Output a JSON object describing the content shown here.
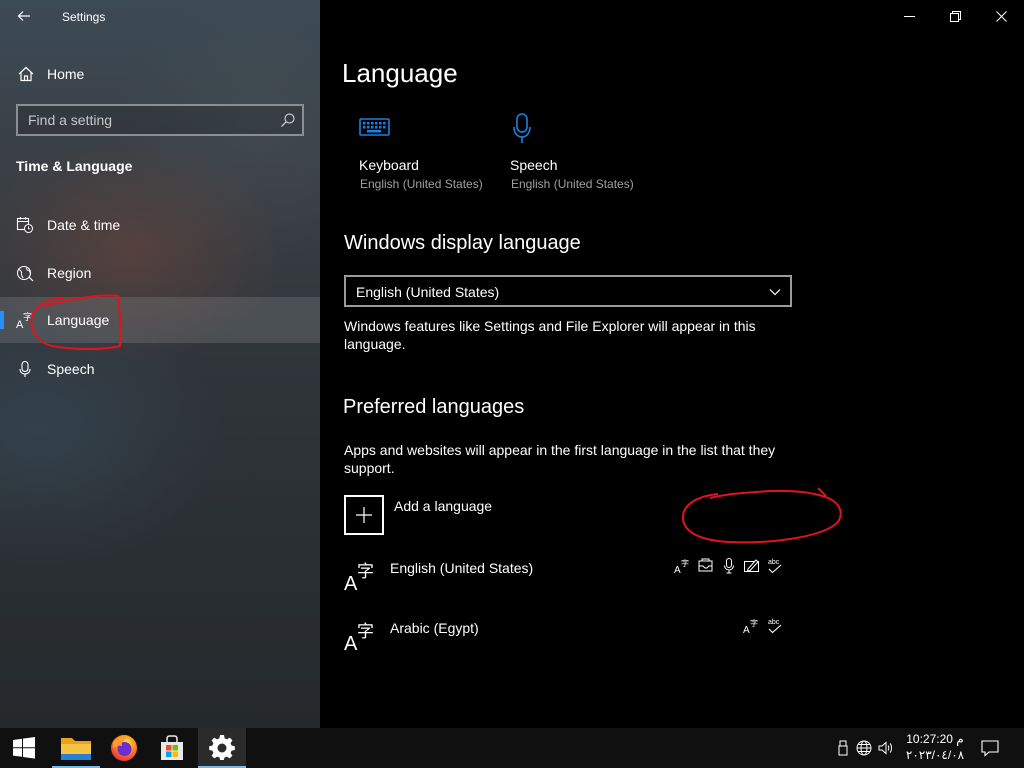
{
  "window": {
    "title": "Settings"
  },
  "sidebar": {
    "home_label": "Home",
    "search_placeholder": "Find a setting",
    "section_title": "Time & Language",
    "items": [
      {
        "label": "Date & time",
        "icon": "date-time-icon",
        "selected": false
      },
      {
        "label": "Region",
        "icon": "region-globe-icon",
        "selected": false
      },
      {
        "label": "Language",
        "icon": "language-icon",
        "selected": true
      },
      {
        "label": "Speech",
        "icon": "microphone-icon",
        "selected": false
      }
    ]
  },
  "main": {
    "page_title": "Language",
    "quick_links": [
      {
        "name": "Keyboard",
        "sub": "English (United States)",
        "icon": "keyboard-icon"
      },
      {
        "name": "Speech",
        "sub": "English (United States)",
        "icon": "microphone-icon"
      }
    ],
    "display_language": {
      "heading": "Windows display language",
      "selected": "English (United States)",
      "description": "Windows features like Settings and File Explorer will appear in this language."
    },
    "preferred": {
      "heading": "Preferred languages",
      "description": "Apps and websites will appear in the first language in the list that they support.",
      "add_label": "Add a language",
      "languages": [
        {
          "name": "English (United States)",
          "features": [
            "language-pack-icon",
            "text-to-speech-icon",
            "speech-recognition-icon",
            "handwriting-icon",
            "spellcheck-icon"
          ]
        },
        {
          "name": "Arabic (Egypt)",
          "features": [
            "language-pack-icon",
            "spellcheck-icon"
          ]
        }
      ]
    }
  },
  "taskbar": {
    "apps": [
      "start-icon",
      "file-explorer-icon",
      "firefox-icon",
      "microsoft-store-icon",
      "settings-gear-icon"
    ],
    "clock_time": "10:27:20 م",
    "clock_date": "٢٠٢٣/٠٤/٠٨"
  },
  "colors": {
    "accent": "#2a8dff",
    "tile_icon_blue": "#1e7fe0",
    "annotation_red": "#e0141e"
  }
}
